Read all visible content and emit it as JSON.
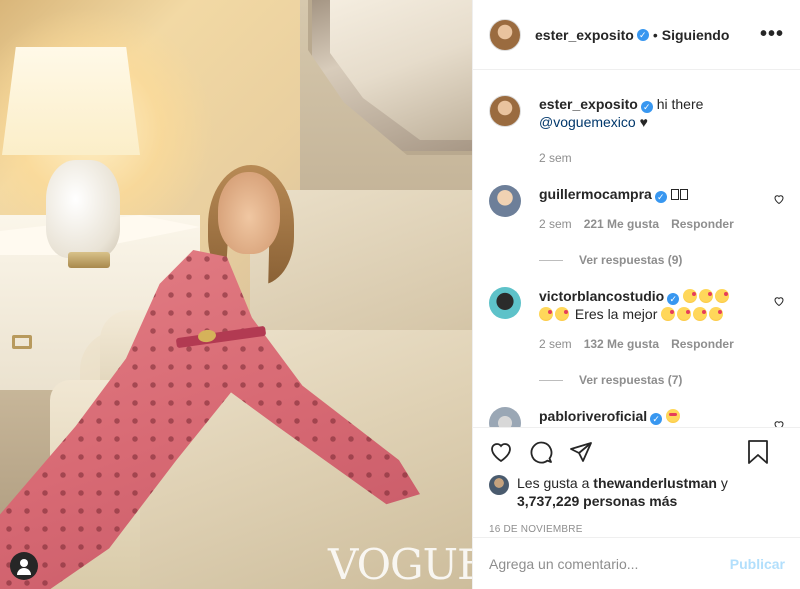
{
  "post": {
    "username": "ester_exposito",
    "follow_status": "Siguiendo",
    "more_glyph": "•••",
    "photo_watermark": "VOGUE",
    "caption": {
      "username": "ester_exposito",
      "text": "hi there",
      "mention": "@voguemexico",
      "suffix": "♥",
      "time": "2 sem"
    }
  },
  "comments": [
    {
      "username": "guillermocampra",
      "time": "2 sem",
      "likes": "221 Me gusta",
      "reply": "Responder",
      "view_replies": "Ver respuestas (9)"
    },
    {
      "username": "victorblancostudio",
      "text": "Eres la mejor",
      "time": "2 sem",
      "likes": "132 Me gusta",
      "reply": "Responder",
      "view_replies": "Ver respuestas (7)"
    },
    {
      "username": "pabloriveroficial"
    }
  ],
  "likes_summary": {
    "prefix": "Les gusta a",
    "liker": "thewanderlustman",
    "conj": "y",
    "count_text": "3,737,229 personas más"
  },
  "date": "16 DE NOVIEMBRE",
  "add_comment": {
    "placeholder": "Agrega un comentario...",
    "publish": "Publicar"
  },
  "colors": {
    "verified": "#3897f0",
    "link": "#00376b",
    "publish_disabled": "#b2dffc",
    "muted": "#8e8e8e"
  }
}
